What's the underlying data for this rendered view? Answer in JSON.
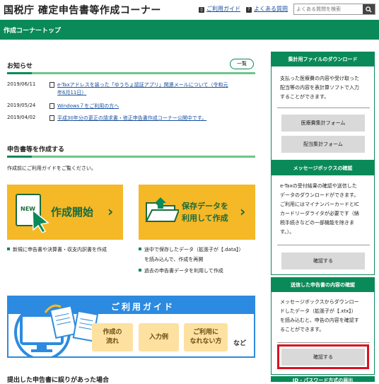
{
  "header": {
    "site_title": "国税庁 確定申告書等作成コーナー",
    "guide_link": "ご利用ガイド",
    "faq_link": "よくある質問",
    "search_placeholder": "よくある質問を検索"
  },
  "nav": {
    "title": "作成コーナートップ"
  },
  "news": {
    "heading": "お知らせ",
    "more_label": "一覧",
    "items": [
      {
        "date": "2019/06/11",
        "text": "e-Taxアドレスを装った「ゆうちょ認証アプリ」関連メールについて（令和元",
        "text2": "年6月11日）"
      },
      {
        "date": "2019/05/24",
        "text": "Windows７をご利用の方へ"
      },
      {
        "date": "2019/04/02",
        "text": "平成30年分の更正の請求書・修正申告書作成コーナー公開中です。"
      }
    ]
  },
  "create": {
    "heading": "申告書等を作成する",
    "intro": "作成前にご利用ガイドをご覧ください。",
    "start_button": {
      "badge": "NEW",
      "label": "作成開始"
    },
    "resume_button": {
      "line1": "保存データを",
      "line2": "利用して作成"
    },
    "start_bullets": [
      "新規に申告書や決算書・収支内訳書を作成"
    ],
    "resume_bullets": [
      "途中で保存したデータ（拡張子が【.data】）",
      "を読み込んで、作成を再開",
      "過去の申告書データを利用して作成"
    ]
  },
  "guide": {
    "title": "ご利用ガイド",
    "btn1_l1": "作成の",
    "btn1_l2": "流れ",
    "btn2": "入力例",
    "btn3_l1": "ご利用に",
    "btn3_l2": "なれない方",
    "etc": "など"
  },
  "bottom": {
    "heading": "提出した申告書に誤りがあった場合"
  },
  "sidebar": {
    "box1": {
      "heading": "集計用ファイルのダウンロード",
      "lines": [
        "支払った医療費の内容や受け取った",
        "配当等の内容を表計算ソフトで入力",
        "することができます。"
      ],
      "btn1": "医療費集計フォーム",
      "btn2": "配当集計フォーム"
    },
    "box2": {
      "heading": "メッセージボックスの確認",
      "lines": [
        "e-Taxの受付結果の確認や送信した",
        "データのダウンロードができます。",
        "ご利用にはマイナンバーカードとIC",
        "カードリーダライタが必要です（納",
        "税手続きなどの一部機能を除きま",
        "す。）。"
      ],
      "btn": "確認する"
    },
    "box3": {
      "heading": "送信した申告書の内容の確認",
      "lines": [
        "メッセージボックスからダウンロー",
        "ドしたデータ（拡張子が【.xtx】）",
        "を読み込むと、申告の内容を確認す",
        "ることができます。"
      ],
      "btn": "確認する"
    },
    "box4": {
      "heading": "ID・パスワード方式の届出"
    }
  },
  "colors": {
    "brand_green": "#0a8a58",
    "light_green": "#6cc58a",
    "button_yellow": "#f5b827",
    "guide_blue": "#2c8be0",
    "highlight_red": "#d9101f"
  }
}
